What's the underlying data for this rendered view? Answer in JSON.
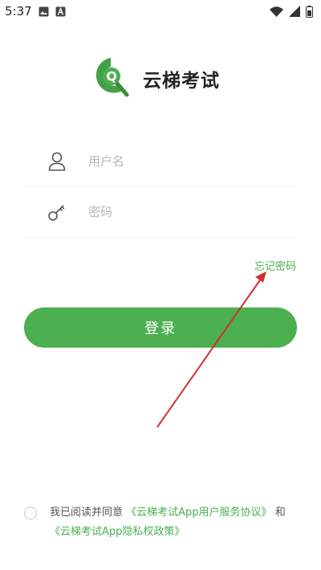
{
  "status_bar": {
    "time": "5:37",
    "icons": [
      "image-icon",
      "a-badge-icon",
      "wifi-icon",
      "signal-icon",
      "battery-icon"
    ]
  },
  "brand": {
    "name": "云梯考试",
    "logo_letter": "Q",
    "color": "#4caf50"
  },
  "login_form": {
    "username_placeholder": "用户名",
    "password_placeholder": "密码",
    "forgot_password": "忘记密码",
    "login_button": "登录"
  },
  "agreement": {
    "prefix": "我已阅读并同意",
    "user_agreement": "《云梯考试App用户服务协议》",
    "and": "和",
    "privacy_policy": "《云梯考试App隐私权政策》"
  },
  "annotation": {
    "arrow_color": "#d32f2f"
  }
}
